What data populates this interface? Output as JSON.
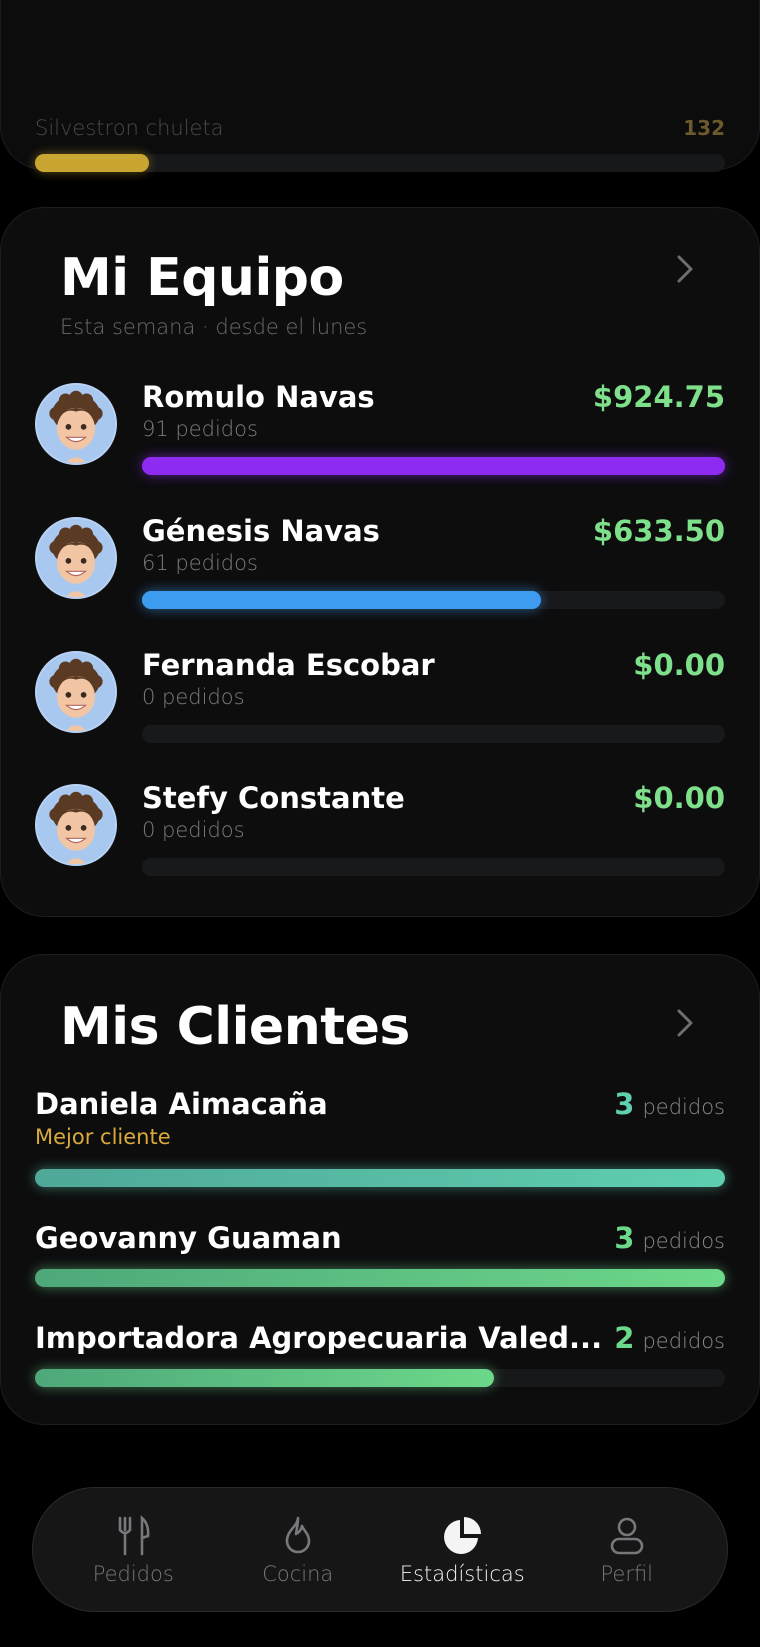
{
  "top_item": {
    "name": "Silvestron chuleta",
    "count": "132",
    "fill": 0.165,
    "color": "#c9a532"
  },
  "team": {
    "title": "Mi Equipo",
    "subtitle": "Esta semana · desde el lunes",
    "members": [
      {
        "name": "Romulo Navas",
        "orders": "91 pedidos",
        "amount": "$924.75",
        "fill": 1.0,
        "color": "#8e2bf0"
      },
      {
        "name": "Génesis Navas",
        "orders": "61 pedidos",
        "amount": "$633.50",
        "fill": 0.685,
        "color": "#3e9cf0"
      },
      {
        "name": "Fernanda Escobar",
        "orders": "0 pedidos",
        "amount": "$0.00",
        "fill": 0,
        "color": "#3e9cf0"
      },
      {
        "name": "Stefy Constante",
        "orders": "0 pedidos",
        "amount": "$0.00",
        "fill": 0,
        "color": "#3e9cf0"
      }
    ]
  },
  "clients": {
    "title": "Mis Clientes",
    "orders_unit": "pedidos",
    "items": [
      {
        "name": "Daniela Aimacaña",
        "tag": "Mejor cliente",
        "count": "3",
        "fill": 1.0,
        "color": "#5fcfb0",
        "num_color": "#5fcfb0"
      },
      {
        "name": "Geovanny Guaman",
        "tag": "",
        "count": "3",
        "fill": 1.0,
        "color": "#6cd88a",
        "num_color": "#6cd88a"
      },
      {
        "name": "Importadora Agropecuaria Valed...",
        "tag": "",
        "count": "2",
        "fill": 0.665,
        "color": "#6cd88a",
        "num_color": "#6cd88a"
      }
    ]
  },
  "nav": {
    "items": [
      {
        "label": "Pedidos",
        "icon": "fork-knife-icon",
        "active": false
      },
      {
        "label": "Cocina",
        "icon": "flame-icon",
        "active": false
      },
      {
        "label": "Estadísticas",
        "icon": "pie-chart-icon",
        "active": true
      },
      {
        "label": "Perfil",
        "icon": "user-icon",
        "active": false
      }
    ]
  }
}
